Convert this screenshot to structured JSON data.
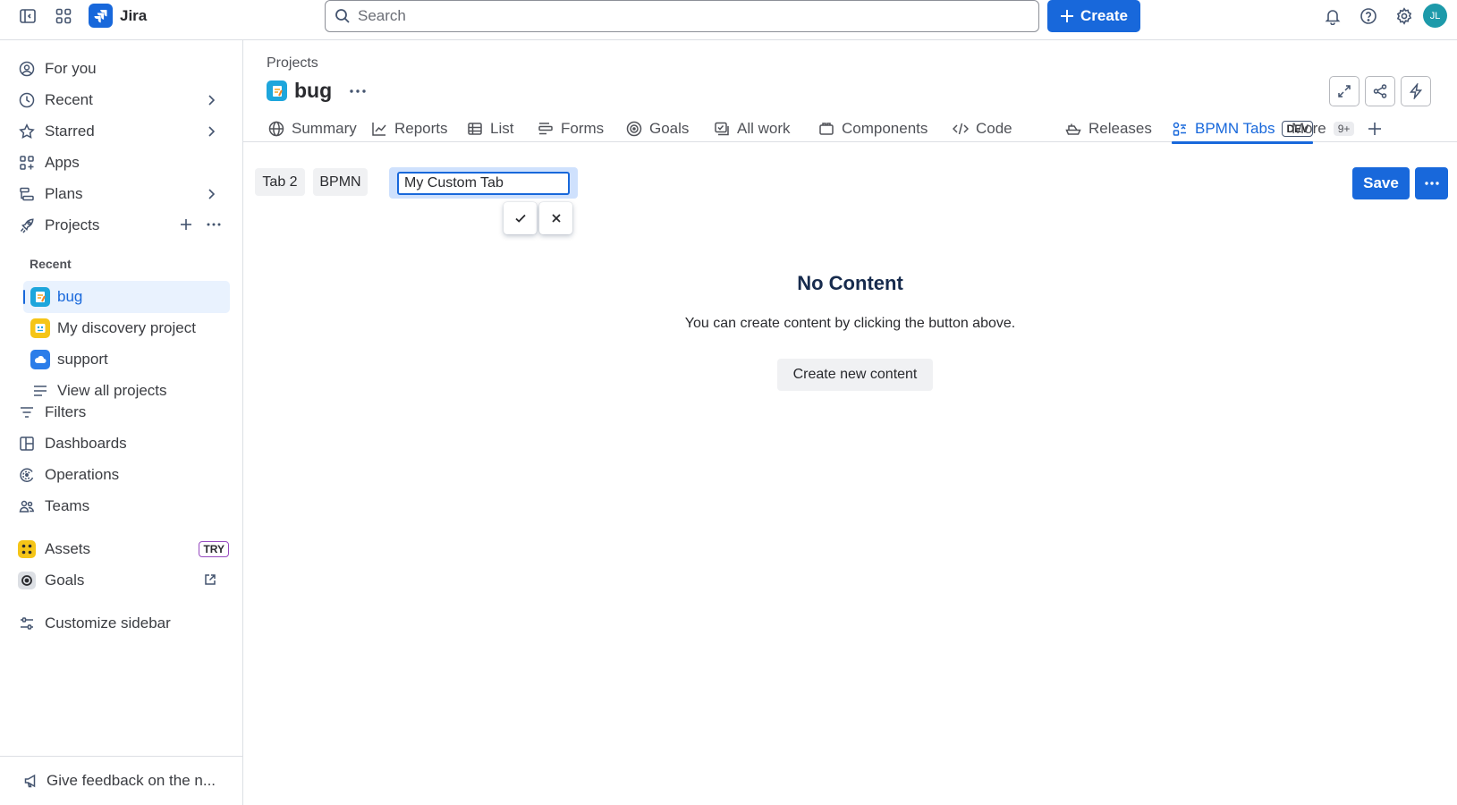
{
  "topbar": {
    "app_name": "Jira",
    "search_placeholder": "Search",
    "create_label": "Create",
    "avatar_initials": "JL"
  },
  "sidebar": {
    "items": [
      {
        "label": "For you",
        "icon": "person-circle-icon"
      },
      {
        "label": "Recent",
        "icon": "clock-icon"
      },
      {
        "label": "Starred",
        "icon": "star-icon"
      },
      {
        "label": "Apps",
        "icon": "apps-icon"
      },
      {
        "label": "Plans",
        "icon": "plans-icon"
      },
      {
        "label": "Projects",
        "icon": "rocket-icon"
      }
    ],
    "recent_heading": "Recent",
    "projects": [
      {
        "label": "bug",
        "selected": true
      },
      {
        "label": "My discovery project",
        "selected": false
      },
      {
        "label": "support",
        "selected": false
      }
    ],
    "view_all": "View all projects",
    "items2": [
      {
        "label": "Filters",
        "icon": "filter-icon"
      },
      {
        "label": "Dashboards",
        "icon": "dashboard-icon"
      },
      {
        "label": "Operations",
        "icon": "operations-icon"
      },
      {
        "label": "Teams",
        "icon": "teams-icon"
      }
    ],
    "assets_label": "Assets",
    "assets_badge": "TRY",
    "goals_label": "Goals",
    "customize_label": "Customize sidebar",
    "feedback_label": "Give feedback on the n..."
  },
  "main": {
    "breadcrumb": "Projects",
    "title": "bug",
    "tabs": [
      {
        "label": "Summary",
        "icon": "globe-icon"
      },
      {
        "label": "Reports",
        "icon": "chart-line-icon"
      },
      {
        "label": "List",
        "icon": "list-table-icon"
      },
      {
        "label": "Forms",
        "icon": "forms-icon"
      },
      {
        "label": "Goals",
        "icon": "target-icon"
      },
      {
        "label": "All work",
        "icon": "all-work-icon"
      },
      {
        "label": "Components",
        "icon": "components-icon"
      },
      {
        "label": "Code",
        "icon": "code-icon"
      },
      {
        "label": "Releases",
        "icon": "ship-icon"
      },
      {
        "label": "BPMN Tabs",
        "icon": "bpmn-icon",
        "badge": "DEV",
        "active": true
      },
      {
        "label": "More",
        "badge": "9+"
      }
    ],
    "subtabs": [
      "Tab 2",
      "BPMN"
    ],
    "edit_value": "My Custom Tab",
    "save_label": "Save",
    "empty": {
      "title": "No Content",
      "description": "You can create content by clicking the button above.",
      "button": "Create new content"
    }
  },
  "colors": {
    "brand": "#1868db",
    "selected_bg": "#e9f2fe",
    "border": "#dcdfe4"
  }
}
